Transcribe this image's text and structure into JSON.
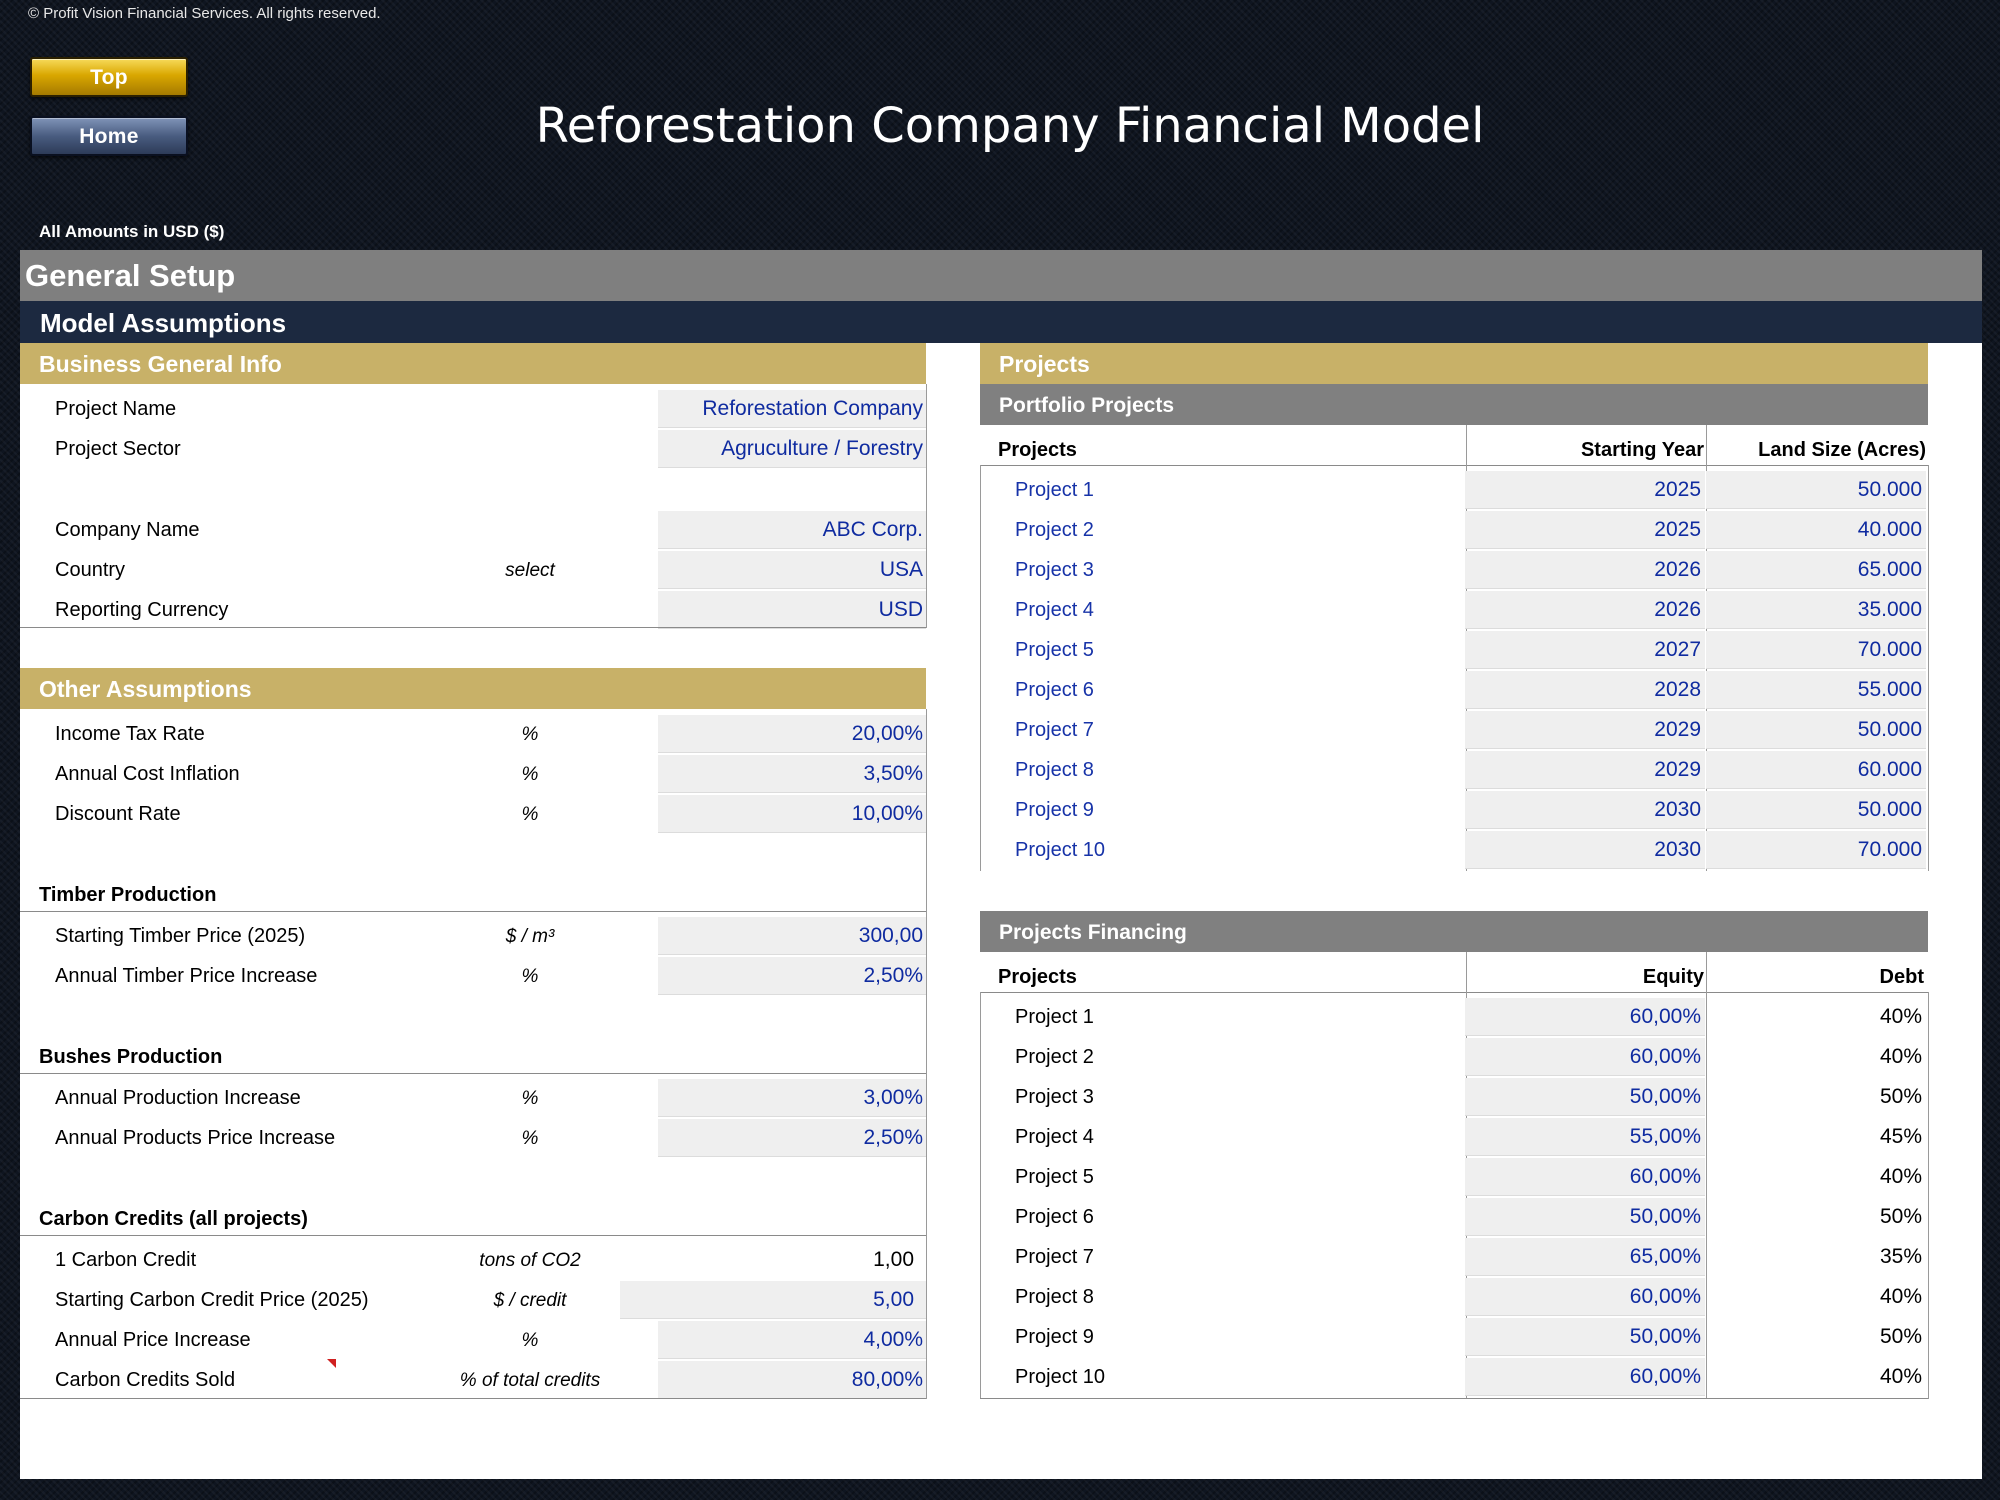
{
  "copyright": "© Profit Vision Financial Services. All rights reserved.",
  "nav": {
    "top_label": "Top",
    "home_label": "Home"
  },
  "title": "Reforestation Company Financial Model",
  "amounts_note": "All Amounts in  USD ($)",
  "general_setup": "General Setup",
  "model_assumptions": "Model Assumptions",
  "business_info": {
    "header": "Business General Info",
    "rows": [
      {
        "label": "Project Name",
        "unit": "",
        "value": "Reforestation Company"
      },
      {
        "label": "Project Sector",
        "unit": "",
        "value": "Agruculture / Forestry"
      },
      {
        "label": "Company Name",
        "unit": "",
        "value": "ABC Corp."
      },
      {
        "label": "Country",
        "unit": "select",
        "value": "USA"
      },
      {
        "label": "Reporting Currency",
        "unit": "",
        "value": "USD"
      }
    ]
  },
  "other_assumptions": {
    "header": "Other Assumptions",
    "rows": [
      {
        "label": "Income Tax Rate",
        "unit": "%",
        "value": "20,00%"
      },
      {
        "label": "Annual Cost Inflation",
        "unit": "%",
        "value": "3,50%"
      },
      {
        "label": "Discount Rate",
        "unit": "%",
        "value": "10,00%"
      }
    ]
  },
  "timber": {
    "title": "Timber Production",
    "rows": [
      {
        "label": "Starting Timber Price (2025)",
        "unit": "$ / m³",
        "value": "300,00"
      },
      {
        "label": "Annual Timber Price Increase",
        "unit": "%",
        "value": "2,50%"
      }
    ]
  },
  "bushes": {
    "title": "Bushes Production",
    "rows": [
      {
        "label": "Annual Production Increase",
        "unit": "%",
        "value": "3,00%"
      },
      {
        "label": "Annual Products Price Increase",
        "unit": "%",
        "value": "2,50%"
      }
    ]
  },
  "carbon": {
    "title": "Carbon Credits (all projects)",
    "rows": [
      {
        "label": "1 Carbon Credit",
        "unit": "tons of CO2",
        "value": "1,00"
      },
      {
        "label": "Starting Carbon Credit Price (2025)",
        "unit": "$ / credit",
        "value": "5,00"
      },
      {
        "label": "Annual Price Increase",
        "unit": "%",
        "value": "4,00%"
      },
      {
        "label": "Carbon Credits Sold",
        "unit": "% of total credits",
        "value": "80,00%"
      }
    ]
  },
  "projects": {
    "header": "Projects",
    "portfolio": {
      "header": "Portfolio Projects",
      "columns": [
        "Projects",
        "Starting Year",
        "Land Size (Acres)"
      ],
      "rows": [
        {
          "name": "Project 1",
          "year": "2025",
          "land": "50.000"
        },
        {
          "name": "Project 2",
          "year": "2025",
          "land": "40.000"
        },
        {
          "name": "Project 3",
          "year": "2026",
          "land": "65.000"
        },
        {
          "name": "Project 4",
          "year": "2026",
          "land": "35.000"
        },
        {
          "name": "Project 5",
          "year": "2027",
          "land": "70.000"
        },
        {
          "name": "Project 6",
          "year": "2028",
          "land": "55.000"
        },
        {
          "name": "Project 7",
          "year": "2029",
          "land": "50.000"
        },
        {
          "name": "Project 8",
          "year": "2029",
          "land": "60.000"
        },
        {
          "name": "Project 9",
          "year": "2030",
          "land": "50.000"
        },
        {
          "name": "Project 10",
          "year": "2030",
          "land": "70.000"
        }
      ]
    },
    "financing": {
      "header": "Projects Financing",
      "columns": [
        "Projects",
        "Equity",
        "Debt"
      ],
      "rows": [
        {
          "name": "Project 1",
          "equity": "60,00%",
          "debt": "40%"
        },
        {
          "name": "Project 2",
          "equity": "60,00%",
          "debt": "40%"
        },
        {
          "name": "Project 3",
          "equity": "50,00%",
          "debt": "50%"
        },
        {
          "name": "Project 4",
          "equity": "55,00%",
          "debt": "45%"
        },
        {
          "name": "Project 5",
          "equity": "60,00%",
          "debt": "40%"
        },
        {
          "name": "Project 6",
          "equity": "50,00%",
          "debt": "50%"
        },
        {
          "name": "Project 7",
          "equity": "65,00%",
          "debt": "35%"
        },
        {
          "name": "Project 8",
          "equity": "60,00%",
          "debt": "40%"
        },
        {
          "name": "Project 9",
          "equity": "50,00%",
          "debt": "50%"
        },
        {
          "name": "Project 10",
          "equity": "60,00%",
          "debt": "40%"
        }
      ]
    }
  }
}
